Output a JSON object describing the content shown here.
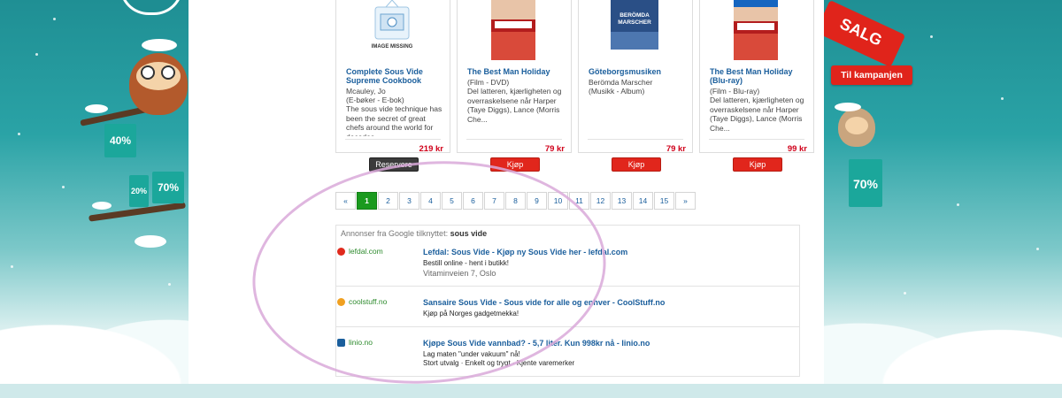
{
  "products": [
    {
      "title": "Complete Sous Vide Supreme Cookbook",
      "meta": [
        "Mcauley, Jo",
        "(E-bøker - E-bok)",
        "The sous vide technique has been the secret of great chefs around the world for decades."
      ],
      "price": "219 kr",
      "button": "Reservere",
      "image_label": "IMAGE MISSING"
    },
    {
      "title": "The Best Man Holiday",
      "meta": [
        "(Film - DVD)",
        "Del latteren, kjærligheten og overraskelsene når Harper (Taye Diggs), Lance (Morris Che..."
      ],
      "price": "79 kr",
      "button": "Kjøp"
    },
    {
      "title": "Göteborgsmusiken",
      "meta": [
        "Berömda Marscher",
        "(Musikk - Album)"
      ],
      "price": "79 kr",
      "button": "Kjøp",
      "image_label": "BERÖMDA MARSCHER"
    },
    {
      "title": "The Best Man Holiday (Blu-ray)",
      "meta": [
        "(Film - Blu-ray)",
        "Del latteren, kjærligheten og overraskelsene når Harper (Taye Diggs), Lance (Morris Che..."
      ],
      "price": "99 kr",
      "button": "Kjøp"
    }
  ],
  "pagination": {
    "prev": "«",
    "next": "»",
    "pages": [
      "1",
      "2",
      "3",
      "4",
      "5",
      "6",
      "7",
      "8",
      "9",
      "10",
      "11",
      "12",
      "13",
      "14",
      "15"
    ],
    "active": "1"
  },
  "ads": {
    "header_prefix": "Annonser fra Google tilknyttet:",
    "header_query": "sous vide",
    "items": [
      {
        "source": "lefdal.com",
        "headline": "Lefdal: Sous Vide - Kjøp ny Sous Vide her - lefdal.com",
        "lines": [
          "Bestill online - hent i butikk!"
        ],
        "address": "Vitaminveien 7, Oslo",
        "icon_color": "#e02a1d"
      },
      {
        "source": "coolstuff.no",
        "headline": "Sansaire Sous Vide - Sous vide for alle og enhver - CoolStuff.no",
        "lines": [
          "Kjøp på Norges gadgetmekka!"
        ],
        "icon_color": "#f0a020"
      },
      {
        "source": "linio.no",
        "headline": "Kjøpe Sous Vide vannbad? - 5,7 liter. Kun 998kr nå - linio.no",
        "lines": [
          "Lag maten \"under vakuum\" nå!",
          "Stort utvalg · Enkelt og trygt · Kjente varemerker"
        ],
        "icon_color": "#1a5e9c"
      }
    ]
  },
  "promo": {
    "salg": "SALG",
    "campaign_button": "Til kampanjen",
    "bag_left_1": "40%",
    "bag_left_2": "20%",
    "bag_left_3": "70%",
    "bag_right": "70%"
  },
  "colors": {
    "accent_red": "#e0241b",
    "link_blue": "#1a5e9c",
    "teal": "#1ba79b",
    "active_page": "#1a9a1e"
  }
}
